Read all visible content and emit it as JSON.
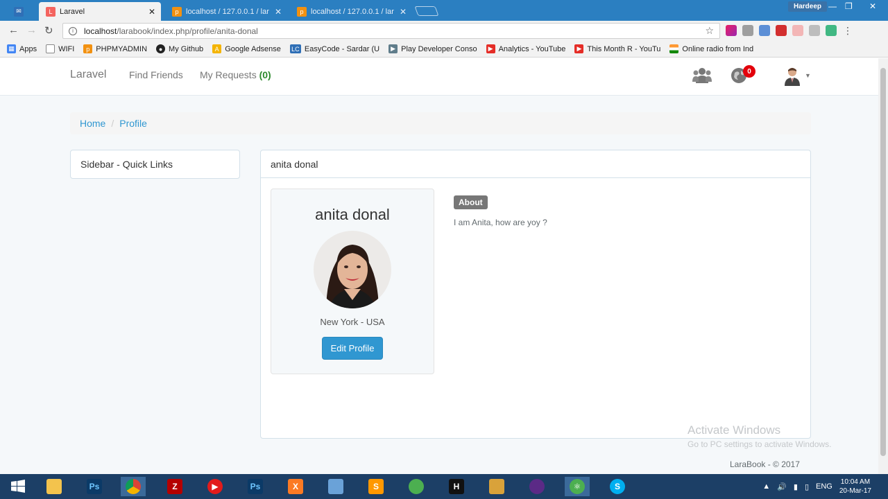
{
  "browser": {
    "tabs": [
      {
        "title": ""
      },
      {
        "title": "Laravel"
      },
      {
        "title": "localhost / 127.0.0.1 / lar"
      },
      {
        "title": "localhost / 127.0.0.1 / lar"
      }
    ],
    "user_chip": "Hardeep",
    "url_host": "localhost",
    "url_path": "/larabook/index.php/profile/anita-donal"
  },
  "bookmarks": [
    {
      "label": "Apps",
      "icon": "apps-grid-icon",
      "color": "#4285f4"
    },
    {
      "label": "WIFI",
      "icon": "page-icon",
      "color": "#888888"
    },
    {
      "label": "PHPMYADMIN",
      "icon": "phpmyadmin-icon",
      "color": "#f29111"
    },
    {
      "label": "My Github",
      "icon": "github-icon",
      "color": "#222222"
    },
    {
      "label": "Google Adsense",
      "icon": "adsense-icon",
      "color": "#f4b400"
    },
    {
      "label": "EasyCode - Sardar (U",
      "icon": "lc-icon",
      "color": "#2f6fb6"
    },
    {
      "label": "Play Developer Conso",
      "icon": "play-icon",
      "color": "#607d8b"
    },
    {
      "label": "Analytics - YouTube",
      "icon": "youtube-icon",
      "color": "#e52d27"
    },
    {
      "label": "This Month R - YouTu",
      "icon": "youtube-icon",
      "color": "#e52d27"
    },
    {
      "label": "Online radio from Ind",
      "icon": "india-flag-icon",
      "color": "#ff9933"
    }
  ],
  "nav": {
    "brand": "Laravel",
    "find_friends": "Find Friends",
    "my_requests": "My Requests",
    "requests_count": "(0)",
    "notification_count": "0"
  },
  "breadcrumb": {
    "home": "Home",
    "separator": "/",
    "current": "Profile"
  },
  "sidebar": {
    "title": "Sidebar - Quick Links"
  },
  "profile": {
    "panel_title": "anita donal",
    "name": "anita donal",
    "location": "New York - USA",
    "edit_button": "Edit Profile",
    "about_label": "About",
    "about_text": "I am Anita, how are yoy ?"
  },
  "watermark": {
    "line1": "Activate Windows",
    "line2": "Go to PC settings to activate Windows."
  },
  "footer": "LaraBook - © 2017",
  "taskbar": {
    "language": "ENG",
    "time": "10:04 AM",
    "date": "20-Mar-17"
  },
  "colors": {
    "chrome_blue": "#2b7fc1",
    "link_blue": "#3097d1",
    "badge_red": "#e3000b",
    "requests_green": "#2d8a2d",
    "taskbar": "#1c3f66"
  }
}
